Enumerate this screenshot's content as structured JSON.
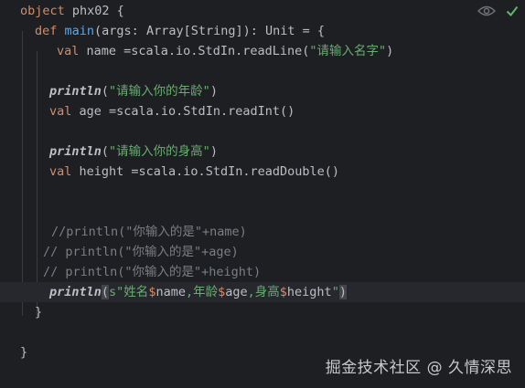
{
  "code": {
    "l1_kw": "object",
    "l1_rest": " phx02 {",
    "l2_kw": "def",
    "l2_fn": "main",
    "l2_rest": "(args: Array[String]): Unit = {",
    "l3_kw": "val",
    "l3_rest": " name =scala.io.StdIn.readLine(",
    "l3_str": "\"请输入名字\"",
    "l3_end": ")",
    "l5_call": "println",
    "l5_open": "(",
    "l5_str": "\"请输入你的年龄\"",
    "l5_end": ")",
    "l6_kw": "val",
    "l6_rest": " age =scala.io.StdIn.readInt()",
    "l8_call": "println",
    "l8_open": "(",
    "l8_str": "\"请输入你的身高\"",
    "l8_end": ")",
    "l9_kw": "val",
    "l9_rest": " height =scala.io.StdIn.readDouble()",
    "l12_comment": "//println(\"你输入的是\"+name)",
    "l13_comment": "// println(\"你输入的是\"+age)",
    "l14_comment": "// println(\"你输入的是\"+height)",
    "l15_call": "println",
    "l15_open": "(",
    "l15_s": "s\"姓名",
    "l15_d1": "$",
    "l15_v1": "name",
    "l15_t1": ",年龄",
    "l15_d2": "$",
    "l15_v2": "age",
    "l15_t2": ",身高",
    "l15_d3": "$",
    "l15_v3": "height",
    "l15_q": "\"",
    "l15_close": ")",
    "l16_close": "}",
    "l18_close": "}"
  },
  "icons": {
    "eye": "eye-icon",
    "check": "check-icon"
  },
  "watermark": "掘金技术社区 @ 久情深思",
  "colors": {
    "background": "#1e1f22",
    "keyword": "#cf8e6d",
    "function": "#56a8f5",
    "string": "#6aab73",
    "comment": "#7a7e85",
    "inspection_ok": "#5fb865"
  }
}
